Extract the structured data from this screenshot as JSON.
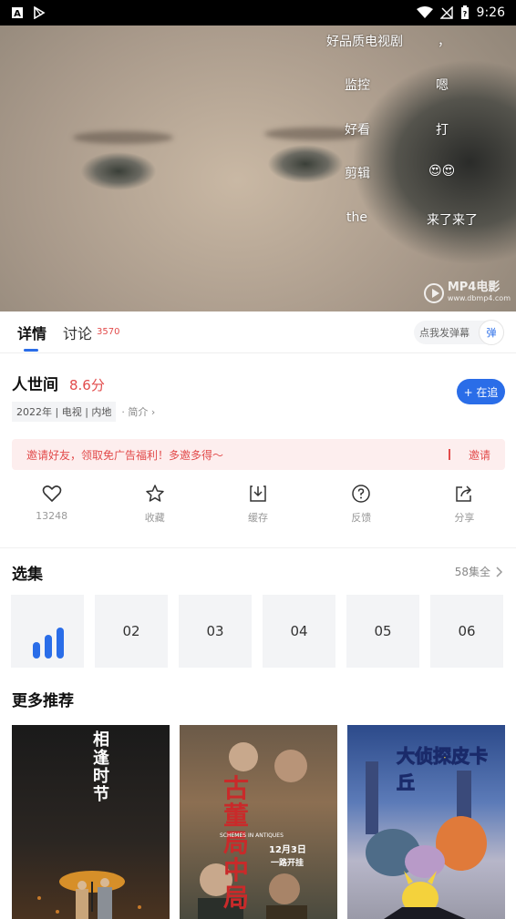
{
  "status_bar": {
    "time": "9:26"
  },
  "video": {
    "danmaku": [
      "好品质电视剧",
      "，",
      "监控",
      "嗯",
      "好看",
      "打",
      "剪辑",
      "😍😍",
      "the",
      "来了来了"
    ],
    "watermark": {
      "brand": "MP4电影",
      "url": "www.dbmp4.com"
    }
  },
  "tabs": {
    "detail": "详情",
    "discuss": "讨论",
    "discuss_count": "3570",
    "danmaku_placeholder": "点我发弹幕",
    "danmaku_btn": "弹"
  },
  "show": {
    "title": "人世间",
    "score": "8.6分",
    "meta": "2022年 | 电视 | 内地",
    "intro": "· 简介 ›",
    "follow": "+ 在追"
  },
  "invite": {
    "text": "邀请好友，领取免广告福利！多邀多得～",
    "action": "邀请"
  },
  "actions": [
    {
      "icon": "heart-icon",
      "label": "13248"
    },
    {
      "icon": "star-icon",
      "label": "收藏"
    },
    {
      "icon": "download-icon",
      "label": "缓存"
    },
    {
      "icon": "help-icon",
      "label": "反馈"
    },
    {
      "icon": "share-icon",
      "label": "分享"
    }
  ],
  "episodes": {
    "title": "选集",
    "all": "58集全",
    "items": [
      "02",
      "03",
      "04",
      "05",
      "06"
    ]
  },
  "recommend": {
    "title": "更多推荐",
    "posters": [
      {
        "title": "相逢时节"
      },
      {
        "title": "古董局中局",
        "subtitle": "SCHEMES IN ANTIQUES",
        "date": "12月3日",
        "note": "一路开挂"
      },
      {
        "title": "大侦探皮卡丘"
      }
    ]
  }
}
